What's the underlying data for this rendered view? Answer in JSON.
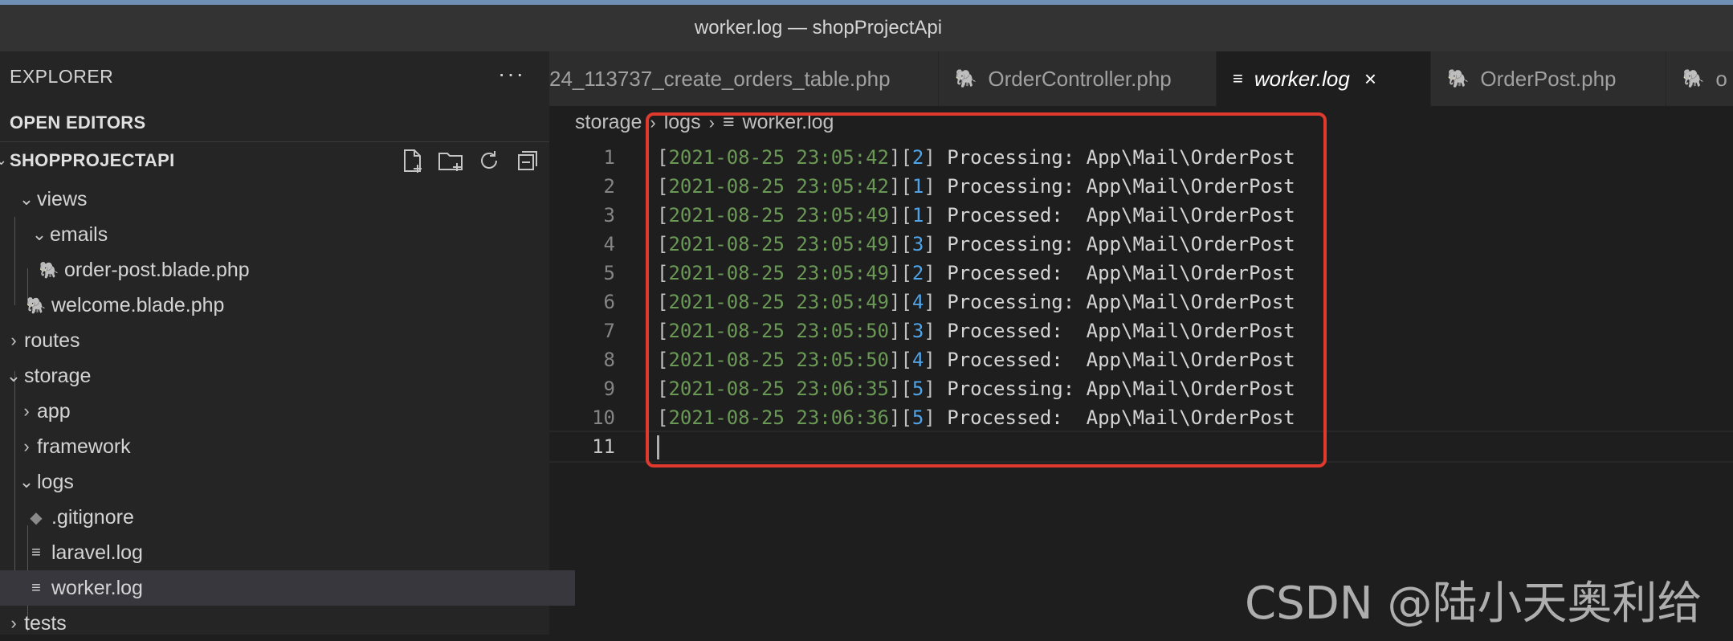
{
  "window": {
    "title": "worker.log — shopProjectApi"
  },
  "sidebar": {
    "header": "EXPLORER",
    "more_icon": "···",
    "open_editors": "OPEN EDITORS",
    "project": "SHOPPROJECTAPI",
    "tree": [
      {
        "label": "views",
        "icon": "chevron-down"
      },
      {
        "label": "emails",
        "icon": "chevron-down"
      },
      {
        "label": "order-post.blade.php",
        "icon": "php-elephant"
      },
      {
        "label": "welcome.blade.php",
        "icon": "php-elephant"
      },
      {
        "label": "routes",
        "icon": "chevron-right"
      },
      {
        "label": "storage",
        "icon": "chevron-down"
      },
      {
        "label": "app",
        "icon": "chevron-right"
      },
      {
        "label": "framework",
        "icon": "chevron-right"
      },
      {
        "label": "logs",
        "icon": "chevron-down"
      },
      {
        "label": ".gitignore",
        "icon": "git-diamond"
      },
      {
        "label": "laravel.log",
        "icon": "lines"
      },
      {
        "label": "worker.log",
        "icon": "lines",
        "selected": true
      },
      {
        "label": "tests",
        "icon": "chevron-right"
      }
    ]
  },
  "tabs": [
    {
      "label": "24_113737_create_orders_table.php",
      "icon": "none"
    },
    {
      "label": "OrderController.php",
      "icon": "php-elephant"
    },
    {
      "label": "worker.log",
      "icon": "lines",
      "active": true,
      "close": "×"
    },
    {
      "label": "OrderPost.php",
      "icon": "php-elephant"
    },
    {
      "label": "o",
      "icon": "php-elephant"
    }
  ],
  "breadcrumb": {
    "part1": "storage",
    "part2": "logs",
    "part3": "worker.log"
  },
  "editor": {
    "lines": [
      {
        "n": "1",
        "date": "2021-08-25 23:05:42",
        "id": "2",
        "rest": " Processing: App\\Mail\\OrderPost"
      },
      {
        "n": "2",
        "date": "2021-08-25 23:05:42",
        "id": "1",
        "rest": " Processing: App\\Mail\\OrderPost"
      },
      {
        "n": "3",
        "date": "2021-08-25 23:05:49",
        "id": "1",
        "rest": " Processed:  App\\Mail\\OrderPost"
      },
      {
        "n": "4",
        "date": "2021-08-25 23:05:49",
        "id": "3",
        "rest": " Processing: App\\Mail\\OrderPost"
      },
      {
        "n": "5",
        "date": "2021-08-25 23:05:49",
        "id": "2",
        "rest": " Processed:  App\\Mail\\OrderPost"
      },
      {
        "n": "6",
        "date": "2021-08-25 23:05:49",
        "id": "4",
        "rest": " Processing: App\\Mail\\OrderPost"
      },
      {
        "n": "7",
        "date": "2021-08-25 23:05:50",
        "id": "3",
        "rest": " Processed:  App\\Mail\\OrderPost"
      },
      {
        "n": "8",
        "date": "2021-08-25 23:05:50",
        "id": "4",
        "rest": " Processed:  App\\Mail\\OrderPost"
      },
      {
        "n": "9",
        "date": "2021-08-25 23:06:35",
        "id": "5",
        "rest": " Processing: App\\Mail\\OrderPost"
      },
      {
        "n": "10",
        "date": "2021-08-25 23:06:36",
        "id": "5",
        "rest": " Processed:  App\\Mail\\OrderPost"
      }
    ],
    "current_line": "11"
  },
  "watermark": "CSDN @陆小天奥利给",
  "colors": {
    "highlight_box": "#e03a2f",
    "date": "#6a9955",
    "number": "#4fa3e6"
  }
}
